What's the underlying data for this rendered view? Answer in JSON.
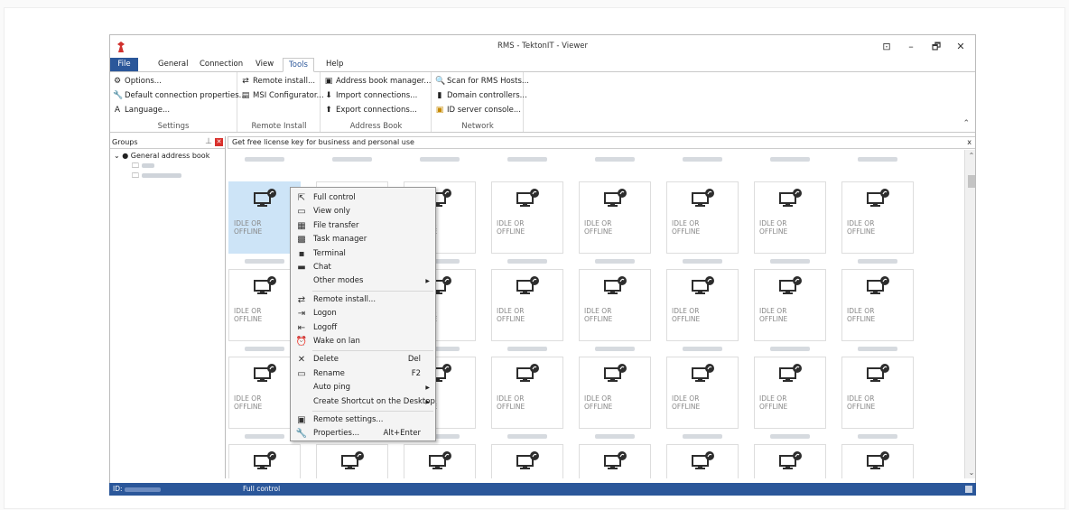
{
  "window": {
    "title": "RMS - TektonIT - Viewer",
    "controls": [
      "⊡",
      "–",
      "🗗",
      "✕"
    ]
  },
  "ribbon": {
    "tabs": [
      {
        "label": "File"
      },
      {
        "label": "General"
      },
      {
        "label": "Connection"
      },
      {
        "label": "View"
      },
      {
        "label": "Tools"
      },
      {
        "label": "Help"
      }
    ],
    "active_tab": "Tools",
    "groups": [
      {
        "name": "Settings",
        "items": [
          {
            "icon": "gear-icon",
            "label": "Options..."
          },
          {
            "icon": "wrench-icon",
            "label": "Default connection properties..."
          },
          {
            "icon": "language-icon",
            "label": "Language..."
          }
        ]
      },
      {
        "name": "Remote Install",
        "items": [
          {
            "icon": "refresh-icon",
            "label": "Remote install..."
          },
          {
            "icon": "msi-icon",
            "label": "MSI Configurator..."
          }
        ]
      },
      {
        "name": "Address Book",
        "items": [
          {
            "icon": "address-book-icon",
            "label": "Address book manager..."
          },
          {
            "icon": "arrow-down-icon",
            "label": "Import connections..."
          },
          {
            "icon": "arrow-up-icon",
            "label": "Export connections..."
          }
        ]
      },
      {
        "name": "Network",
        "items": [
          {
            "icon": "search-icon",
            "label": "Scan for RMS Hosts..."
          },
          {
            "icon": "server-icon",
            "label": "Domain controllers..."
          },
          {
            "icon": "id-server-icon",
            "label": "ID server console..."
          }
        ]
      }
    ]
  },
  "groups_panel": {
    "title": "Groups",
    "root": "General address book"
  },
  "info_bar": {
    "text": "Get free license key for business and personal use",
    "close": "x"
  },
  "tiles": {
    "status_line1": "IDLE OR",
    "status_line2": "OFFLINE"
  },
  "context_menu": {
    "items": [
      {
        "icon": "cursor-icon",
        "label": "Full control",
        "shortcut": "",
        "submenu": false
      },
      {
        "icon": "monitor-icon",
        "label": "View only",
        "shortcut": "",
        "submenu": false
      },
      {
        "icon": "file-transfer-icon",
        "label": "File transfer",
        "shortcut": "",
        "submenu": false
      },
      {
        "icon": "task-manager-icon",
        "label": "Task manager",
        "shortcut": "",
        "submenu": false
      },
      {
        "icon": "terminal-icon",
        "label": "Terminal",
        "shortcut": "",
        "submenu": false
      },
      {
        "icon": "chat-icon",
        "label": "Chat",
        "shortcut": "",
        "submenu": false
      },
      {
        "icon": "",
        "label": "Other modes",
        "shortcut": "",
        "submenu": true
      },
      {
        "separator": true
      },
      {
        "icon": "refresh-icon",
        "label": "Remote install...",
        "shortcut": "",
        "submenu": false
      },
      {
        "icon": "logon-icon",
        "label": "Logon",
        "shortcut": "",
        "submenu": false
      },
      {
        "icon": "logoff-icon",
        "label": "Logoff",
        "shortcut": "",
        "submenu": false
      },
      {
        "icon": "alarm-clock-icon",
        "label": "Wake on lan",
        "shortcut": "",
        "submenu": false
      },
      {
        "separator": true
      },
      {
        "icon": "delete-icon",
        "label": "Delete",
        "shortcut": "Del",
        "submenu": false
      },
      {
        "icon": "rename-icon",
        "label": "Rename",
        "shortcut": "F2",
        "submenu": false
      },
      {
        "icon": "",
        "label": "Auto ping",
        "shortcut": "",
        "submenu": true
      },
      {
        "icon": "",
        "label": "Create Shortcut on the Desktop",
        "shortcut": "",
        "submenu": true
      },
      {
        "separator": true
      },
      {
        "icon": "remote-settings-icon",
        "label": "Remote settings...",
        "shortcut": "",
        "submenu": false
      },
      {
        "icon": "properties-icon",
        "label": "Properties...",
        "shortcut": "Alt+Enter",
        "submenu": false
      }
    ]
  },
  "status_bar": {
    "id_label": "ID:",
    "mode": "Full control"
  },
  "colors": {
    "accent": "#2b579a",
    "selection": "#cde4f7",
    "close_red": "#d9302c"
  }
}
